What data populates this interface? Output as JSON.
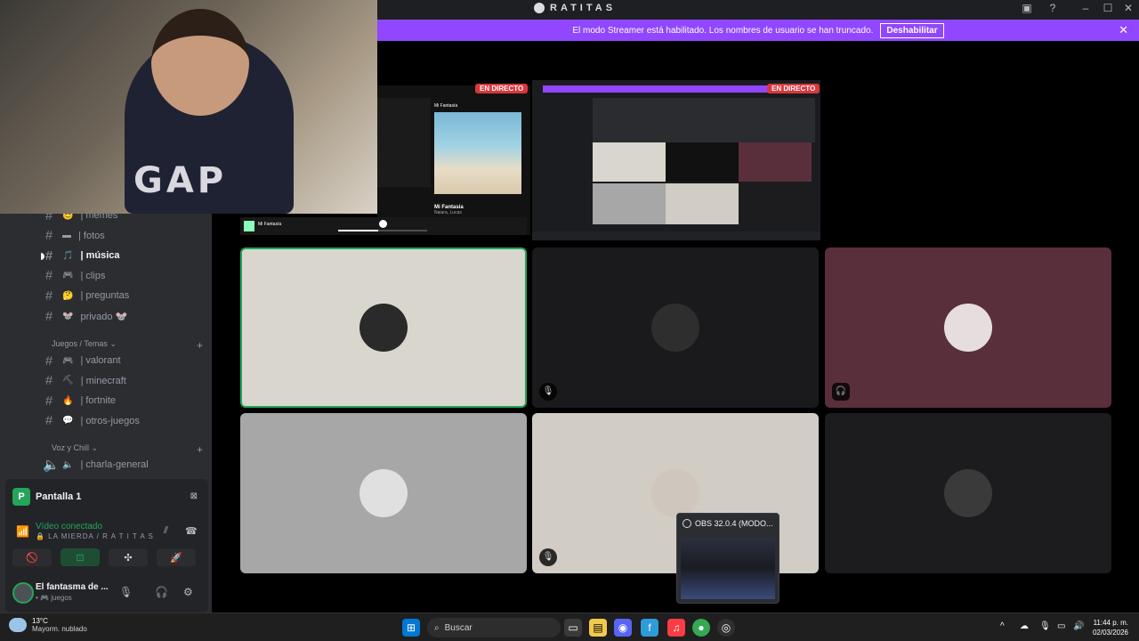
{
  "window": {
    "title": "RATITAS",
    "controls": {
      "minimize": "–",
      "maximize": "☐",
      "close": "✕"
    }
  },
  "banner": {
    "text": "El modo Streamer está habilitado. Los nombres de usuario se han truncado.",
    "button": "Deshabilitar",
    "close": "✕"
  },
  "webcam": {
    "shirt_text": "GAP"
  },
  "sidebar": {
    "channels_top": [
      {
        "emoji": "😊",
        "label": "| memes"
      },
      {
        "emoji": "▬",
        "label": "| fotos"
      },
      {
        "emoji": "🎵",
        "label": "| música",
        "active": true
      },
      {
        "emoji": "🎮",
        "label": "| clips"
      },
      {
        "emoji": "🤔",
        "label": "| preguntas"
      },
      {
        "emoji": "🐭",
        "label": "privado 🐭"
      }
    ],
    "category_games": "Juegos / Temas ⌄",
    "channels_games": [
      {
        "emoji": "🎮",
        "label": "| valorant"
      },
      {
        "emoji": "⛏",
        "label": "| minecraft"
      },
      {
        "emoji": "🔥",
        "label": "| fortnite"
      },
      {
        "emoji": "💬",
        "label": "| otros-juegos"
      }
    ],
    "category_voice": "Voz y Chill ⌄",
    "voice_channel": "| charla-general",
    "plus": "+"
  },
  "voice_panel": {
    "share_app_letter": "P",
    "share_title": "Pantalla 1",
    "status": "Vídeo conectado",
    "channel": "🔒 LA MIERDA / R A T I T A S",
    "buttons": [
      "🚫",
      "⊡",
      "✣",
      "🚀"
    ],
    "user_name": "El fantasma de ...",
    "user_status": "• 🎮 juegos"
  },
  "streams": {
    "live_label": "EN DIRECTO",
    "spotify": {
      "song": "Mi Fantasía",
      "artist": "Naiara, Lucas",
      "header": "Mi Fantasía"
    }
  },
  "tiles": [
    {
      "name": "tile-user-1",
      "bg": "#d9d6cd",
      "border": "#23a55a",
      "avatar": "#2a2a2a",
      "mute": ""
    },
    {
      "name": "tile-user-2",
      "bg": "#1a1a1c",
      "border": "",
      "avatar": "#2e2e2e",
      "mute": "🎙"
    },
    {
      "name": "tile-user-3",
      "bg": "#5a2f3c",
      "border": "",
      "avatar": "#e6dede",
      "mute": "🎧"
    },
    {
      "name": "tile-user-4",
      "bg": "#a7a7a7",
      "border": "",
      "avatar": "#e0e0e0",
      "mute": ""
    },
    {
      "name": "tile-user-5",
      "bg": "#d1ccc4",
      "border": "",
      "avatar": "#cfc6bd",
      "mute": "🎙"
    },
    {
      "name": "tile-user-6",
      "bg": "#1c1c1e",
      "border": "",
      "avatar": "#3a3a3a",
      "mute": ""
    }
  ],
  "obs_popup": {
    "title": "OBS 32.0.4 (MODO..."
  },
  "taskbar": {
    "temp": "13°C",
    "weather": "Mayorm. nublado",
    "search_placeholder": "Buscar",
    "time": "11:44 p. m.",
    "date": "02/03/2026"
  }
}
